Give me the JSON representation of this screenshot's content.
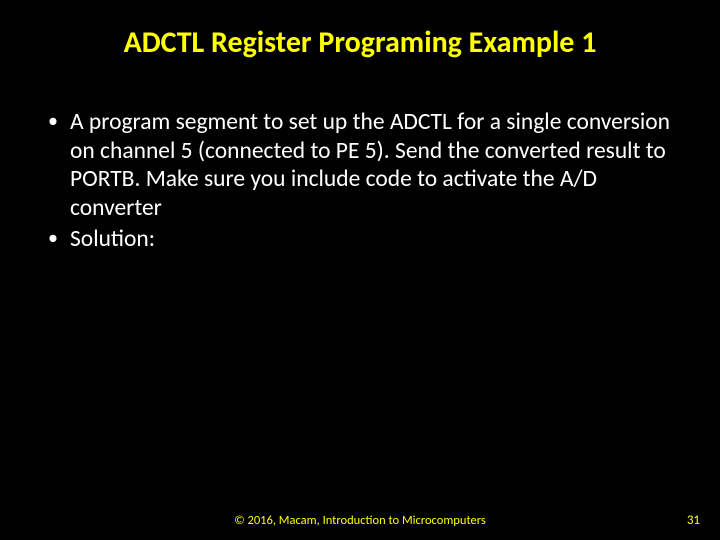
{
  "title": "ADCTL Register Programing Example 1",
  "bullets": [
    "A program segment to set up the ADCTL for a single conversion on channel 5 (connected to PE 5). Send the converted result to PORTB. Make sure you include code to activate the A/D converter",
    "Solution:"
  ],
  "footer": "© 2016, Macam, Introduction to Microcomputers",
  "page_number": "31"
}
